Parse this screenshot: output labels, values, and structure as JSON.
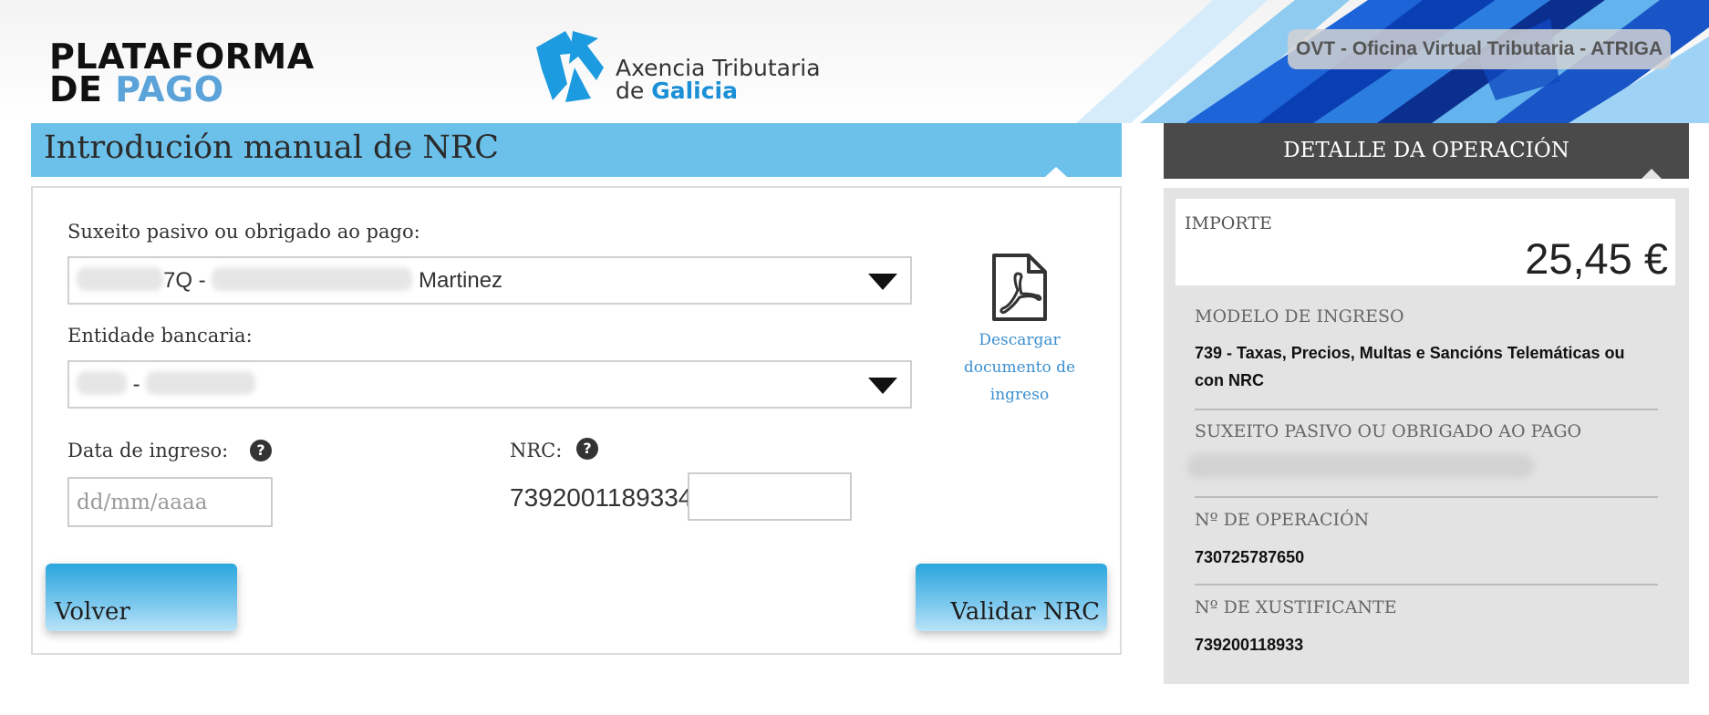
{
  "header": {
    "platform_logo_line1": "PLATAFORMA",
    "platform_logo_line2_a": "DE",
    "platform_logo_line2_b": "PAGO",
    "atg_logo_line1": "Axencia Tributaria",
    "atg_logo_line2_a": "de",
    "atg_logo_line2_b": "Galicia",
    "ovt_badge": "OVT - Oficina Virtual Tributaria - ATRIGA"
  },
  "form": {
    "title": "Introdución manual de NRC",
    "taxpayer_label": "Suxeito pasivo ou obrigado ao pago:",
    "taxpayer_value_part1": "7Q -",
    "taxpayer_value_part2": "Martinez",
    "bank_label": "Entidade bancaria:",
    "bank_value_separator": "-",
    "pdf_link_label": "Descargar documento de ingreso",
    "date_label": "Data de ingreso:",
    "date_placeholder": "dd/mm/aaaa",
    "nrc_label": "NRC:",
    "nrc_prefix": "7392001189334",
    "nrc_suffix_value": "",
    "help_glyph": "?",
    "back_button": "Volver",
    "validate_button": "Validar NRC"
  },
  "detail": {
    "header": "DETALLE DA OPERACIÓN",
    "amount_label": "IMPORTE",
    "amount_value": "25,45 €",
    "model_label": "MODELO DE INGRESO",
    "model_value": "739 - Taxas, Precios, Multas e Sancións Telemáticas ou con NRC",
    "taxpayer_label": "SUXEITO PASIVO OU OBRIGADO AO PAGO",
    "operation_label": "Nº DE OPERACIÓN",
    "operation_value": "730725787650",
    "receipt_label": "Nº DE XUSTIFICANTE",
    "receipt_value": "739200118933"
  },
  "colors": {
    "accent_blue": "#6cc1ea",
    "button_blue": "#2aa6dd",
    "link_blue": "#3c8fcf",
    "dark_header": "#4a4a4a",
    "panel_grey": "#e3e3e3"
  },
  "icons": [
    "pdf-document-icon",
    "help-icon",
    "dropdown-caret-icon",
    "atg-arrows-logo"
  ]
}
